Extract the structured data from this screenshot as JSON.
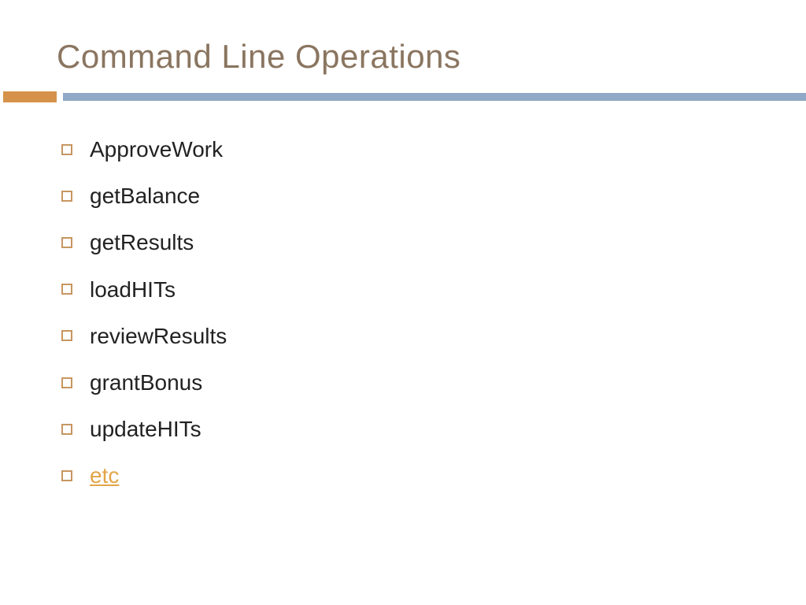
{
  "title": "Command Line Operations",
  "colors": {
    "title": "#8a7560",
    "accent": "#d6924a",
    "bar": "#8fa9c6",
    "bullet_border": "#c79660",
    "link": "#e2a547",
    "text": "#222222"
  },
  "items": [
    {
      "label": "ApproveWork",
      "link": false
    },
    {
      "label": "getBalance",
      "link": false
    },
    {
      "label": "getResults",
      "link": false
    },
    {
      "label": "loadHITs",
      "link": false
    },
    {
      "label": "reviewResults",
      "link": false
    },
    {
      "label": "grantBonus",
      "link": false
    },
    {
      "label": "updateHITs",
      "link": false
    },
    {
      "label": "etc",
      "link": true
    }
  ]
}
